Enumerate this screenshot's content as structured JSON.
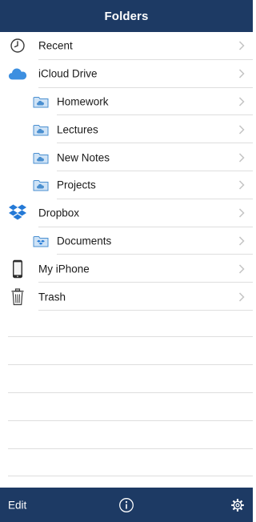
{
  "header": {
    "title": "Folders"
  },
  "folders": [
    {
      "label": "Recent",
      "icon": "clock-icon",
      "level": 0
    },
    {
      "label": "iCloud Drive",
      "icon": "cloud-icon",
      "level": 0
    },
    {
      "label": "Homework",
      "icon": "cloud-folder-icon",
      "level": 1
    },
    {
      "label": "Lectures",
      "icon": "cloud-folder-icon",
      "level": 1
    },
    {
      "label": "New Notes",
      "icon": "cloud-folder-icon",
      "level": 1
    },
    {
      "label": "Projects",
      "icon": "cloud-folder-icon",
      "level": 1
    },
    {
      "label": "Dropbox",
      "icon": "dropbox-icon",
      "level": 0
    },
    {
      "label": "Documents",
      "icon": "dropbox-folder-icon",
      "level": 1
    },
    {
      "label": "My iPhone",
      "icon": "iphone-icon",
      "level": 0
    },
    {
      "label": "Trash",
      "icon": "trash-icon",
      "level": 0
    }
  ],
  "toolbar": {
    "edit_label": "Edit",
    "info_icon": "info-icon",
    "settings_icon": "gear-icon"
  },
  "colors": {
    "bar": "#1d3a64",
    "cloud": "#3d8fe0",
    "dropbox": "#2479d6",
    "separator": "#dedede",
    "chevron": "#c4c4c4"
  }
}
